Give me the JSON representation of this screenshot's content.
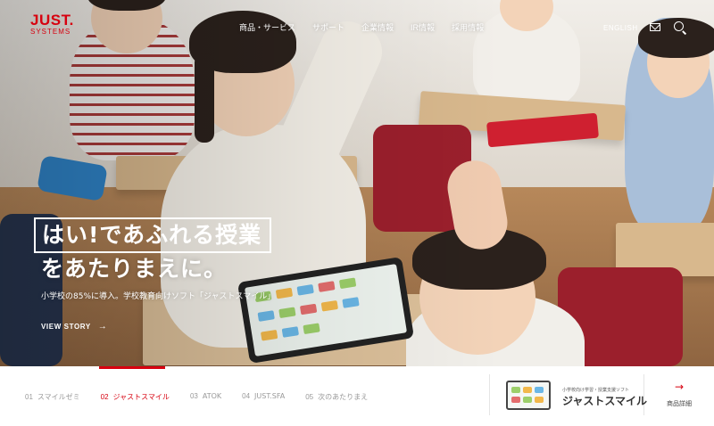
{
  "logo": {
    "line1": "JUST.",
    "line2": "SYSTEMS"
  },
  "nav": {
    "items": [
      "商品・サービス",
      "サポート",
      "企業情報",
      "IR情報",
      "採用情報"
    ]
  },
  "header_utils": {
    "english": "ENGLISH",
    "mail_icon": "mail-icon",
    "search_icon": "search-icon"
  },
  "hero": {
    "headline_line1": "はい!であふれる授業",
    "headline_line2": "をあたりまえに。",
    "subcopy": "小学校の85%に導入。学校教育向けソフト「ジャストスマイル」",
    "cta_label": "VIEW STORY",
    "cta_arrow": "→"
  },
  "slides": {
    "active_index": 1,
    "items": [
      {
        "num": "01",
        "label": "スマイルゼミ"
      },
      {
        "num": "02",
        "label": "ジャストスマイル"
      },
      {
        "num": "03",
        "label": "ATOK"
      },
      {
        "num": "04",
        "label": "JUST.SFA"
      },
      {
        "num": "05",
        "label": "次のあたりまえ"
      }
    ]
  },
  "product": {
    "caption": "小学校向け学習・授業支援ソフト",
    "name": "ジャストスマイル"
  },
  "detail": {
    "arrow": "→",
    "label": "商品詳細"
  },
  "colors": {
    "brand": "#d7000f",
    "tab_inactive": "#999999"
  }
}
